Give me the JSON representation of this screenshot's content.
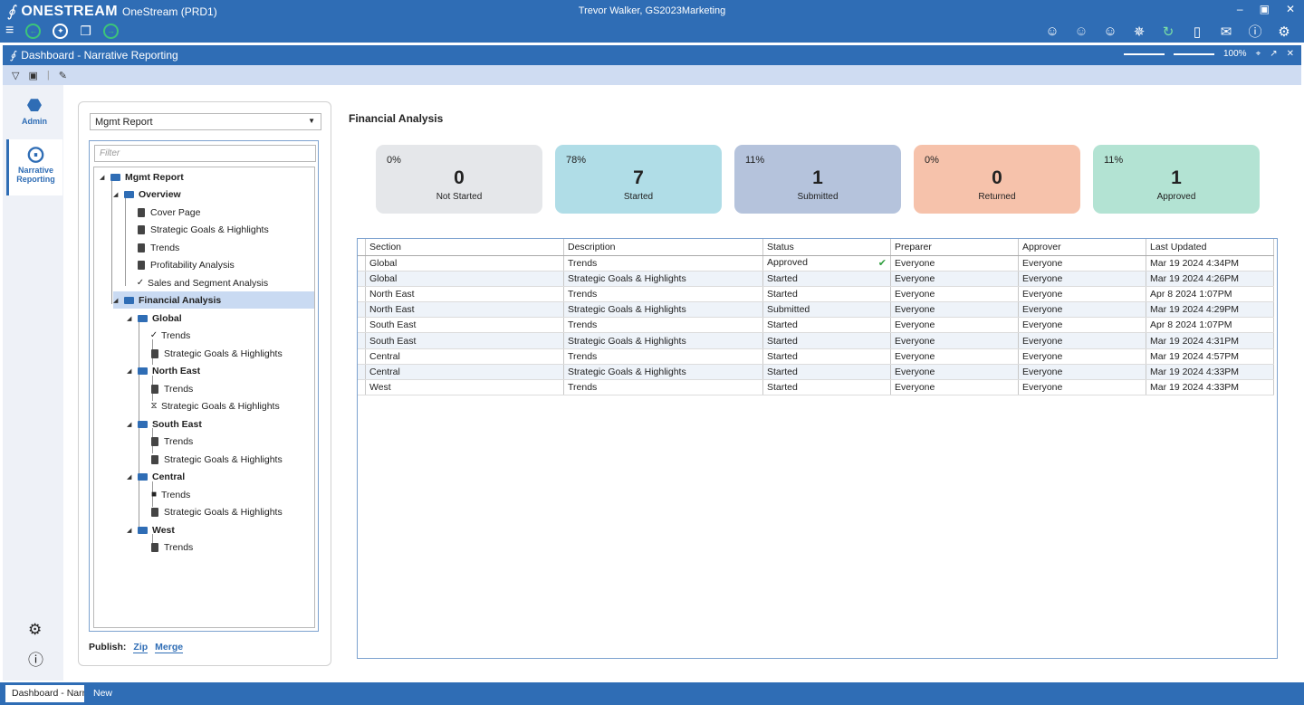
{
  "app": {
    "brand": "ONESTREAM",
    "instance": "OneStream (PRD1)",
    "user": "Trevor Walker, GS2023Marketing"
  },
  "dashboard": {
    "title": "Dashboard - Narrative Reporting",
    "zoom": "100%"
  },
  "nav": {
    "admin": "Admin",
    "narrative": "Narrative Reporting"
  },
  "tree_panel": {
    "report_select": "Mgmt Report",
    "filter_placeholder": "Filter",
    "nodes": [
      {
        "label": "Mgmt Report",
        "kind": "folder"
      },
      {
        "label": "Overview",
        "kind": "folder"
      },
      {
        "label": "Cover Page",
        "kind": "doc"
      },
      {
        "label": "Strategic Goals & Highlights",
        "kind": "doc"
      },
      {
        "label": "Trends",
        "kind": "doc"
      },
      {
        "label": "Profitability Analysis",
        "kind": "doc"
      },
      {
        "label": "Sales and Segment Analysis",
        "kind": "check"
      },
      {
        "label": "Financial Analysis",
        "kind": "folder"
      },
      {
        "label": "Global",
        "kind": "folder"
      },
      {
        "label": "Trends",
        "kind": "check"
      },
      {
        "label": "Strategic Goals & Highlights",
        "kind": "doc"
      },
      {
        "label": "North East",
        "kind": "folder"
      },
      {
        "label": "Trends",
        "kind": "doc"
      },
      {
        "label": "Strategic Goals & Highlights",
        "kind": "hourglass"
      },
      {
        "label": "South East",
        "kind": "folder"
      },
      {
        "label": "Trends",
        "kind": "doc"
      },
      {
        "label": "Strategic Goals & Highlights",
        "kind": "doc"
      },
      {
        "label": "Central",
        "kind": "folder"
      },
      {
        "label": "Trends",
        "kind": "lock"
      },
      {
        "label": "Strategic Goals & Highlights",
        "kind": "doc"
      },
      {
        "label": "West",
        "kind": "folder"
      },
      {
        "label": "Trends",
        "kind": "doc"
      }
    ],
    "publish_label": "Publish:",
    "zip": "Zip",
    "merge": "Merge"
  },
  "main": {
    "title": "Financial Analysis",
    "cards": [
      {
        "pct": "0%",
        "count": "0",
        "label": "Not Started",
        "color": "#e5e7ea"
      },
      {
        "pct": "78%",
        "count": "7",
        "label": "Started",
        "color": "#b0dde7"
      },
      {
        "pct": "11%",
        "count": "1",
        "label": "Submitted",
        "color": "#b5c3dc"
      },
      {
        "pct": "0%",
        "count": "0",
        "label": "Returned",
        "color": "#f6c2ab"
      },
      {
        "pct": "11%",
        "count": "1",
        "label": "Approved",
        "color": "#b3e3d3"
      }
    ],
    "columns": [
      "Section",
      "Description",
      "Status",
      "Preparer",
      "Approver",
      "Last Updated"
    ],
    "rows": [
      [
        "Global",
        "Trends",
        "Approved",
        "Everyone",
        "Everyone",
        "Mar 19 2024  4:34PM"
      ],
      [
        "Global",
        "Strategic Goals & Highlights",
        "Started",
        "Everyone",
        "Everyone",
        "Mar 19 2024  4:26PM"
      ],
      [
        "North East",
        "Trends",
        "Started",
        "Everyone",
        "Everyone",
        "Apr  8 2024  1:07PM"
      ],
      [
        "North East",
        "Strategic Goals & Highlights",
        "Submitted",
        "Everyone",
        "Everyone",
        "Mar 19 2024  4:29PM"
      ],
      [
        "South East",
        "Trends",
        "Started",
        "Everyone",
        "Everyone",
        "Apr  8 2024  1:07PM"
      ],
      [
        "South East",
        "Strategic Goals & Highlights",
        "Started",
        "Everyone",
        "Everyone",
        "Mar 19 2024  4:31PM"
      ],
      [
        "Central",
        "Trends",
        "Started",
        "Everyone",
        "Everyone",
        "Mar 19 2024  4:57PM"
      ],
      [
        "Central",
        "Strategic Goals & Highlights",
        "Started",
        "Everyone",
        "Everyone",
        "Mar 19 2024  4:33PM"
      ],
      [
        "West",
        "Trends",
        "Started",
        "Everyone",
        "Everyone",
        "Mar 19 2024  4:33PM"
      ]
    ]
  },
  "tabs": {
    "active": "Dashboard - Narrative Reporting",
    "new": "New"
  }
}
